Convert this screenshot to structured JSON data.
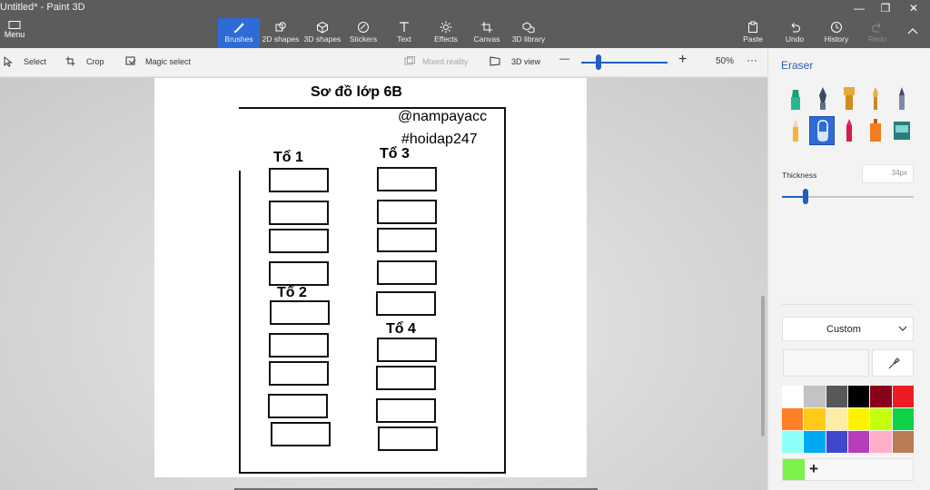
{
  "window": {
    "title": "Untitled* - Paint 3D",
    "controls": {
      "minimize": "—",
      "restore": "❐",
      "close": "✕"
    }
  },
  "ribbon": {
    "menu_label": "Menu",
    "tools": [
      {
        "label": "Brushes",
        "icon": "brush-icon",
        "active": true
      },
      {
        "label": "2D shapes",
        "icon": "2d-shapes-icon"
      },
      {
        "label": "3D shapes",
        "icon": "3d-shapes-icon"
      },
      {
        "label": "Stickers",
        "icon": "stickers-icon"
      },
      {
        "label": "Text",
        "icon": "text-icon"
      },
      {
        "label": "Effects",
        "icon": "effects-icon"
      },
      {
        "label": "Canvas",
        "icon": "canvas-icon"
      },
      {
        "label": "3D library",
        "icon": "3d-library-icon"
      }
    ],
    "actions": [
      {
        "label": "Paste",
        "icon": "paste-icon"
      },
      {
        "label": "Undo",
        "icon": "undo-icon"
      },
      {
        "label": "History",
        "icon": "history-icon"
      },
      {
        "label": "Redo",
        "icon": "redo-icon",
        "disabled": true
      }
    ],
    "active_color": "#2e6bd6"
  },
  "toolbar": {
    "select_label": "Select",
    "crop_label": "Crop",
    "magic_select_label": "Magic select",
    "mixed_reality_label": "Mixed reality",
    "view_3d_label": "3D view",
    "zoom_out": "—",
    "zoom_in": "+",
    "zoom_level": "50%",
    "zoom_fraction": 0.2,
    "more": "···"
  },
  "canvas": {
    "heading": "Sơ đồ lớp 6B",
    "watermark_1": "@nampayacc",
    "watermark_2": "#hoidap247",
    "group_1": "Tổ 1",
    "group_2": "Tổ 2",
    "group_3": "Tổ 3",
    "group_4": "Tổ 4"
  },
  "panel": {
    "title": "Eraser",
    "thickness_label": "Thickness",
    "thickness_value": "34px",
    "thickness_fraction": 0.18,
    "color_mode": "Custom",
    "add_color": "+",
    "current_color": "#7cf24a",
    "brushes": [
      {
        "icon": "marker-icon",
        "selected": false
      },
      {
        "icon": "calligraphy-pen-icon",
        "selected": false
      },
      {
        "icon": "oil-brush-icon",
        "selected": false
      },
      {
        "icon": "watercolor-icon",
        "selected": false
      },
      {
        "icon": "pixel-pen-icon",
        "selected": false
      },
      {
        "icon": "pencil-icon",
        "selected": false
      },
      {
        "icon": "eraser-icon",
        "selected": true
      },
      {
        "icon": "crayon-icon",
        "selected": false
      },
      {
        "icon": "spray-can-icon",
        "selected": false
      },
      {
        "icon": "fill-icon",
        "selected": false
      }
    ],
    "palette": [
      "#ffffff",
      "#c3c3c3",
      "#585858",
      "#000000",
      "#88001b",
      "#ec1c24",
      "#ff7f27",
      "#ffca18",
      "#fdeca6",
      "#fff200",
      "#c4ff0e",
      "#0ed145",
      "#8cfffb",
      "#00a8f3",
      "#3f48cc",
      "#b83dba",
      "#ffaec8",
      "#b97a56"
    ]
  }
}
